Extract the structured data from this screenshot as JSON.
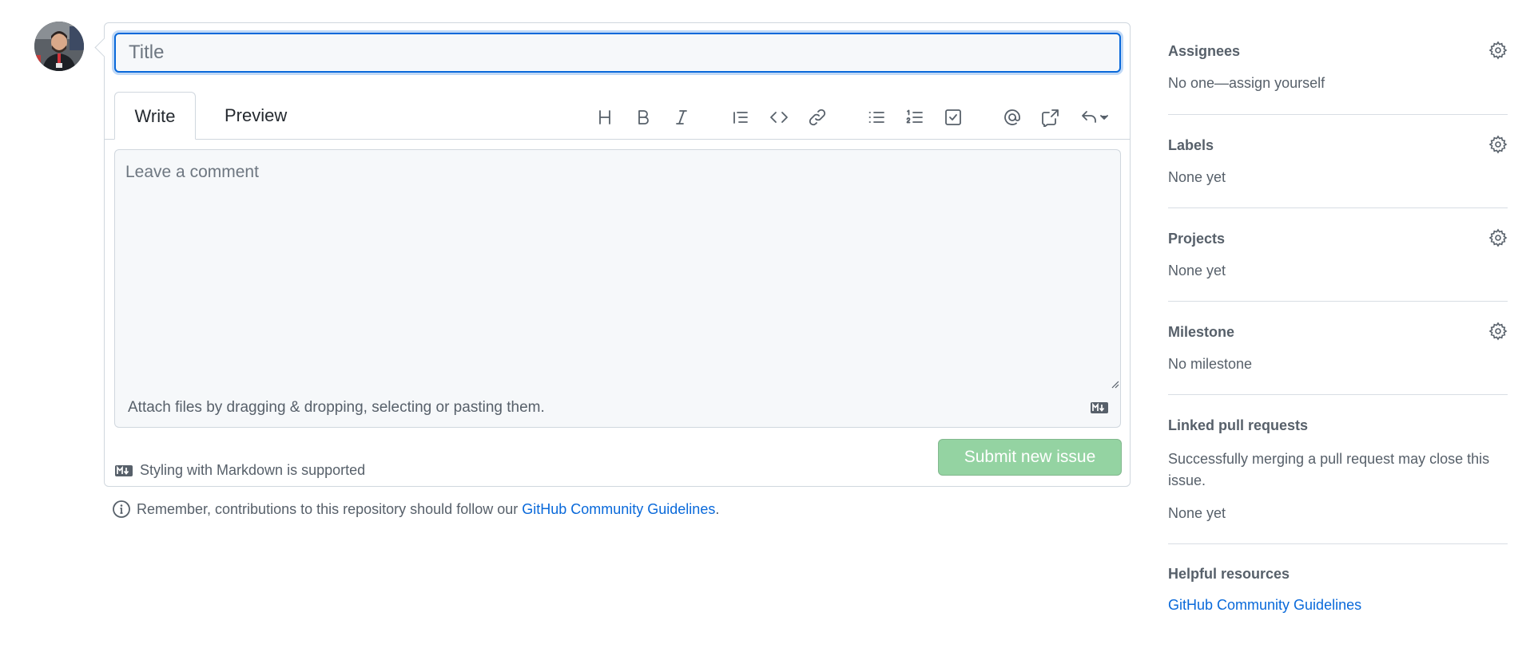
{
  "issue_form": {
    "title_placeholder": "Title",
    "tabs": {
      "write": "Write",
      "preview": "Preview"
    },
    "toolbar": [
      "heading-icon",
      "bold-icon",
      "italic-icon",
      "quote-icon",
      "code-icon",
      "link-icon",
      "bulleted-list-icon",
      "numbered-list-icon",
      "task-list-icon",
      "mention-icon",
      "cross-reference-icon",
      "reply-icon"
    ],
    "comment_placeholder": "Leave a comment",
    "attach_text": "Attach files by dragging & dropping, selecting or pasting them.",
    "markdown_note": "Styling with Markdown is supported",
    "submit_label": "Submit new issue"
  },
  "guidelines": {
    "text": "Remember, contributions to this repository should follow our ",
    "link": "GitHub Community Guidelines",
    "period": "."
  },
  "sidebar": {
    "assignees": {
      "heading": "Assignees",
      "value": "No one—assign yourself"
    },
    "labels": {
      "heading": "Labels",
      "value": "None yet"
    },
    "projects": {
      "heading": "Projects",
      "value": "None yet"
    },
    "milestone": {
      "heading": "Milestone",
      "value": "No milestone"
    },
    "linked_prs": {
      "heading": "Linked pull requests",
      "description": "Successfully merging a pull request may close this issue.",
      "value": "None yet"
    },
    "helpful": {
      "heading": "Helpful resources",
      "link": "GitHub Community Guidelines"
    }
  },
  "colors": {
    "accent": "#0969da",
    "submit_disabled": "#94d3a2",
    "text_muted": "#57606a",
    "border": "#d0d7de"
  }
}
